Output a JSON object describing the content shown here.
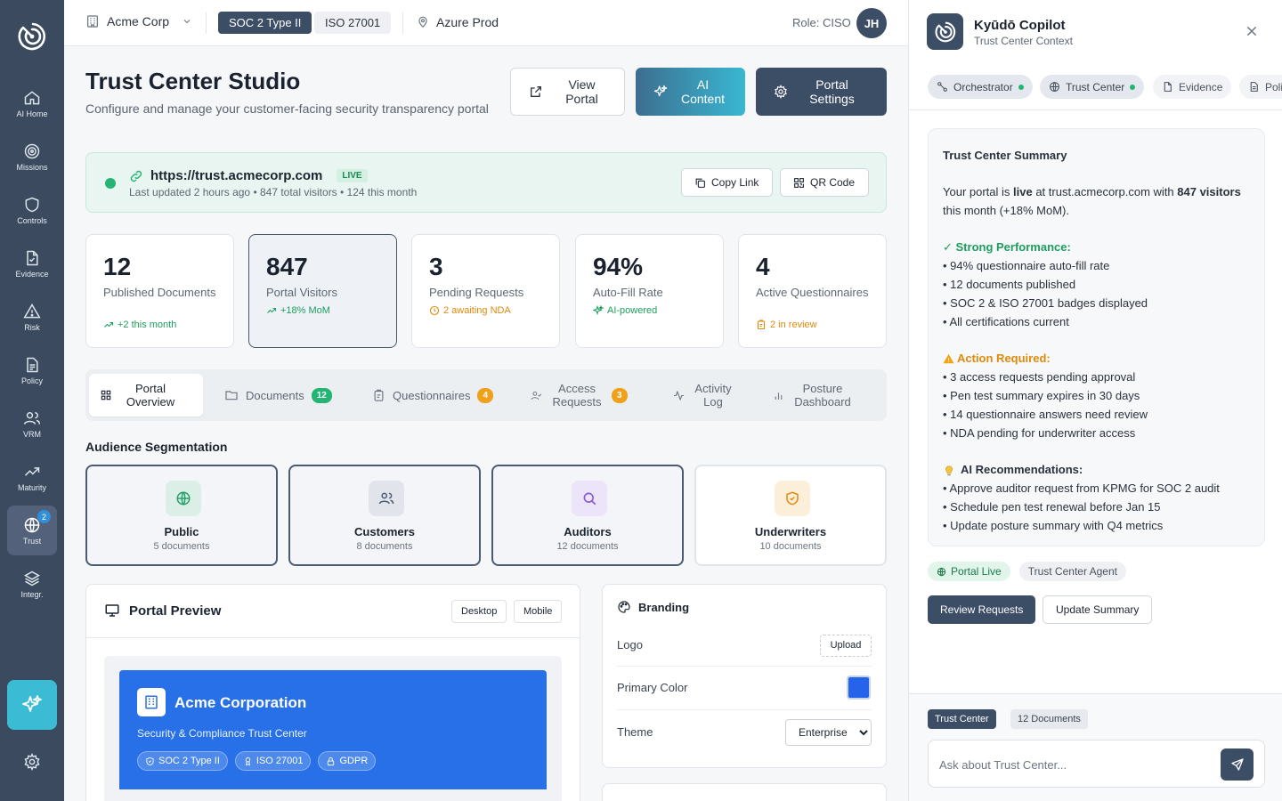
{
  "nav": {
    "items": [
      {
        "label": "AI Home",
        "icon": "home-icon"
      },
      {
        "label": "Missions",
        "icon": "target-icon"
      },
      {
        "label": "Controls",
        "icon": "shield-icon"
      },
      {
        "label": "Evidence",
        "icon": "file-icon"
      },
      {
        "label": "Risk",
        "icon": "warning-icon"
      },
      {
        "label": "Policy",
        "icon": "document-icon"
      },
      {
        "label": "VRM",
        "icon": "users-icon"
      },
      {
        "label": "Maturity",
        "icon": "trending-icon"
      },
      {
        "label": "Trust",
        "icon": "globe-icon",
        "badge": "2",
        "active": true
      },
      {
        "label": "Integr.",
        "icon": "layers-icon"
      }
    ]
  },
  "topbar": {
    "org": "Acme Corp",
    "frameworks": [
      "SOC 2 Type II",
      "ISO 27001"
    ],
    "environment": "Azure Prod",
    "role": "Role: CISO",
    "avatar_initials": "JH"
  },
  "header": {
    "title": "Trust Center Studio",
    "subtitle": "Configure and manage your customer-facing security transparency portal",
    "buttons": {
      "view_portal": "View Portal",
      "ai_content": "AI Content",
      "portal_settings": "Portal Settings"
    }
  },
  "portal": {
    "url": "https://trust.acmecorp.com",
    "status": "LIVE",
    "meta": "Last updated 2 hours ago • 847 total visitors • 124 this month",
    "copy_link": "Copy Link",
    "qr_code": "QR Code"
  },
  "stats": [
    {
      "value": "12",
      "label": "Published Documents",
      "delta": "+2 this month"
    },
    {
      "value": "847",
      "label": "Portal Visitors",
      "delta": "+18% MoM"
    },
    {
      "value": "3",
      "label": "Pending Requests",
      "delta": "2 awaiting NDA"
    },
    {
      "value": "94%",
      "label": "Auto-Fill Rate",
      "delta": "AI-powered"
    },
    {
      "value": "4",
      "label": "Active Questionnaires",
      "delta": "2 in review"
    }
  ],
  "tabs": [
    {
      "label": "Portal Overview"
    },
    {
      "label": "Documents",
      "badge": "12"
    },
    {
      "label": "Questionnaires",
      "badge": "4"
    },
    {
      "label": "Access Requests",
      "badge": "3"
    },
    {
      "label": "Activity Log"
    },
    {
      "label": "Posture Dashboard"
    }
  ],
  "audience": {
    "heading": "Audience Segmentation",
    "segments": [
      {
        "name": "Public",
        "count": "5 documents"
      },
      {
        "name": "Customers",
        "count": "8 documents"
      },
      {
        "name": "Auditors",
        "count": "12 documents"
      },
      {
        "name": "Underwriters",
        "count": "10 documents"
      }
    ]
  },
  "preview": {
    "title": "Portal Preview",
    "desktop": "Desktop",
    "mobile": "Mobile",
    "company": "Acme Corporation",
    "tagline": "Security & Compliance Trust Center",
    "badges": [
      "SOC 2 Type II",
      "ISO 27001",
      "GDPR"
    ],
    "brand_color": "#2870e8"
  },
  "branding": {
    "title": "Branding",
    "logo_label": "Logo",
    "upload": "Upload",
    "color_label": "Primary Color",
    "primary_color": "#2563eb",
    "theme_label": "Theme",
    "theme_value": "Enterprise"
  },
  "copilot": {
    "title": "Kyūdō Copilot",
    "subtitle": "Trust Center Context",
    "chips": [
      "Orchestrator",
      "Trust Center",
      "Evidence",
      "Poli"
    ],
    "summary": {
      "heading": "Trust Center Summary",
      "intro_1": "Your portal is ",
      "intro_bold_1": "live",
      "intro_2": " at trust.acmecorp.com with ",
      "intro_bold_2": "847 visitors",
      "intro_3": " this month (+18% MoM).",
      "strong_heading": "✓ Strong Performance:",
      "strong_items": [
        "• 94% questionnaire auto-fill rate",
        "• 12 documents published",
        "• SOC 2 & ISO 27001 badges displayed",
        "• All certifications current"
      ],
      "action_heading": "Action Required:",
      "action_items": [
        "• 3 access requests pending approval",
        "• Pen test summary expires in 30 days",
        "• 14 questionnaire answers need review",
        "• NDA pending for underwriter access"
      ],
      "rec_heading": "AI Recommendations:",
      "rec_items": [
        "• Approve auditor request from KPMG for SOC 2 audit",
        "• Schedule pen test renewal before Jan 15",
        "• Update posture summary with Q4 metrics"
      ]
    },
    "tags": [
      "Portal Live",
      "Trust Center Agent"
    ],
    "actions": {
      "review": "Review Requests",
      "update": "Update Summary"
    },
    "context": [
      "Trust Center",
      "12 Documents"
    ],
    "input_placeholder": "Ask about Trust Center..."
  },
  "colors": {
    "rail": "#3b4a5e",
    "navy": "#3c4d66",
    "accent_teal": "#3cbcd4",
    "success": "#22b573",
    "warning": "#e08a0b"
  }
}
